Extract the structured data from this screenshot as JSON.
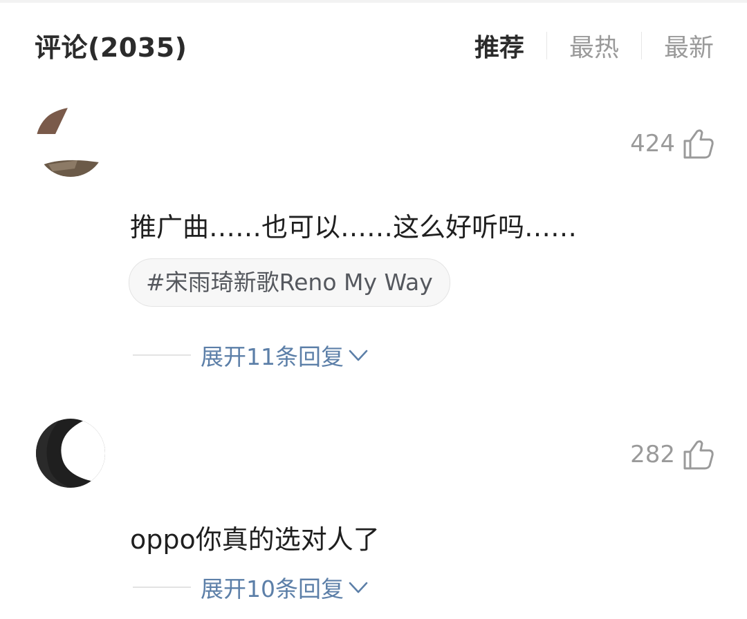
{
  "header": {
    "title": "评论(2035)",
    "tabs": [
      {
        "label": "推荐",
        "active": true
      },
      {
        "label": "最热",
        "active": false
      },
      {
        "label": "最新",
        "active": false
      }
    ]
  },
  "comments": [
    {
      "likes": "424",
      "text": "推广曲……也可以……这么好听吗……",
      "topic": "#宋雨琦新歌Reno My Way",
      "expand_label": "展开11条回复"
    },
    {
      "likes": "282",
      "text": "oppo你真的选对人了",
      "expand_label": "展开10条回复"
    }
  ],
  "colors": {
    "accent_link": "#5c7fa8",
    "muted": "#9a9a9a",
    "text": "#1f1f1f"
  },
  "icons": {
    "like": "thumbs-up-icon",
    "expand": "chevron-down-icon"
  }
}
